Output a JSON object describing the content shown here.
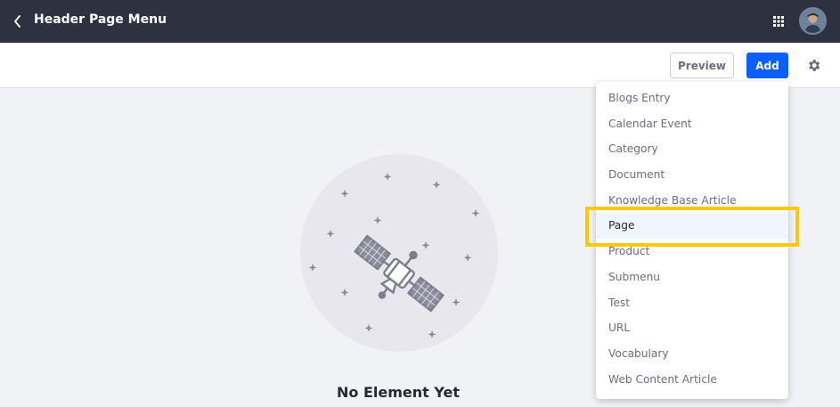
{
  "header": {
    "title": "Header Page Menu",
    "back_icon": "chevron-left-icon",
    "apps_icon": "apps-grid-icon",
    "avatar_icon": "user-avatar"
  },
  "toolbar": {
    "preview_label": "Preview",
    "add_label": "Add",
    "settings_icon": "gear-icon"
  },
  "empty_state": {
    "title": "No Element Yet",
    "illustration_icon": "satellite-icon"
  },
  "dropdown": {
    "items": [
      {
        "label": "Blogs Entry"
      },
      {
        "label": "Calendar Event"
      },
      {
        "label": "Category"
      },
      {
        "label": "Document"
      },
      {
        "label": "Knowledge Base Article"
      },
      {
        "label": "Page",
        "selected": true
      },
      {
        "label": "Product"
      },
      {
        "label": "Submenu"
      },
      {
        "label": "Test"
      },
      {
        "label": "URL"
      },
      {
        "label": "Vocabulary"
      },
      {
        "label": "Web Content Article"
      }
    ]
  },
  "colors": {
    "topbar": "#2e3140",
    "primary": "#0b5fff",
    "highlight": "#ffc800",
    "background": "#f1f2f5"
  }
}
